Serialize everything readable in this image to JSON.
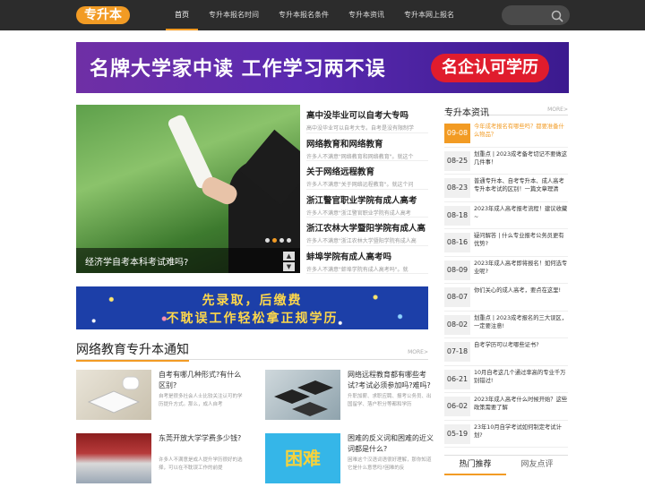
{
  "header": {
    "logo": "专升本",
    "nav": [
      "首页",
      "专升本报名时间",
      "专升本报名条件",
      "专升本资讯",
      "专升本网上报名"
    ]
  },
  "banner": {
    "text": "名牌大学家中读  工作学习两不误",
    "pill": "名企认可学历"
  },
  "slider": {
    "caption": "经济学自考本科考试难吗?"
  },
  "news": [
    {
      "title": "高中没毕业可以自考大专吗",
      "desc": "高中没毕业可以自考大专。自考是没有限制学"
    },
    {
      "title": "网络教育和网络教育",
      "desc": "许多人不满意\"网络教育和网络教育\"。就这个"
    },
    {
      "title": "关于网络远程教育",
      "desc": "许多人不满意\"关于网络远程教育\"。就这个问"
    },
    {
      "title": "浙江警官职业学院有成人高考",
      "desc": "许多人不满意\"浙江警官职业学院有成人高考"
    },
    {
      "title": "浙江农林大学暨阳学院有成人高",
      "desc": "许多人不满意\"浙江农林大学暨阳学院有成人高"
    },
    {
      "title": "蚌埠学院有成人高考吗",
      "desc": "许多人不满意\"蚌埠学院有成人高考吗\"。就"
    }
  ],
  "ad2": {
    "line1": "先录取，后缴费",
    "line2": "不耽误工作轻松拿正规学历"
  },
  "section": {
    "title": "网络教育专升本通知",
    "more": "MORE>",
    "cards": [
      {
        "title": "自考有哪几种形式?有什么区别?",
        "desc": "自考是很多社会人士比较关注认可的学历提升方式。那么，成人自考"
      },
      {
        "title": "网络远程教育都有哪些考试?考试必须参加吗?难吗?",
        "desc": "升职加薪、求职应聘、报考公务员、出国留学、落户积分等都和学历"
      },
      {
        "title": "东莞开放大学学费多少钱?",
        "desc": "许多人不满意是成人提升学历很好的选择，可以在不耽误工作的前提"
      },
      {
        "title": "困难的反义词和困难的近义词都是什么?",
        "desc": "困难这个汉语词语很好理解，那你知道它是什么意思吗?困难的反"
      }
    ],
    "card4_img_text": "困难"
  },
  "right": {
    "title": "专升本资讯",
    "more": "MORE>",
    "items": [
      {
        "date": "09-08",
        "text": "今年成考报名有哪些吗？都要准备什么物品？"
      },
      {
        "date": "08-25",
        "text": "划重点 | 2023成考备考切记不要做这几件事！"
      },
      {
        "date": "08-23",
        "text": "普通专升本、自考专升本、成人高考专升本考试的区别！一篇文章理清"
      },
      {
        "date": "08-18",
        "text": "2023年成人高考报考流程！建议收藏~"
      },
      {
        "date": "08-16",
        "text": "疑问解答 | 什么专业报考公务员更有优势?"
      },
      {
        "date": "08-09",
        "text": "2023年成人高考即将报名！如何选专业呢?"
      },
      {
        "date": "08-07",
        "text": "你们关心的成人高考，要点在这里!"
      },
      {
        "date": "08-02",
        "text": "划重点 | 2023成考报名的三大误区，一定要注意!"
      },
      {
        "date": "07-18",
        "text": "自考学历可以考哪些证书?"
      },
      {
        "date": "06-21",
        "text": "10月自考这几个通过率高的专业千万别错过!"
      },
      {
        "date": "06-02",
        "text": "2023年成人高考什么时候开始？这些政策需要了解"
      },
      {
        "date": "05-19",
        "text": "23年10月自学考试如何制定考试计划?"
      }
    ],
    "tabs": [
      "热门推荐",
      "网友点评"
    ]
  }
}
